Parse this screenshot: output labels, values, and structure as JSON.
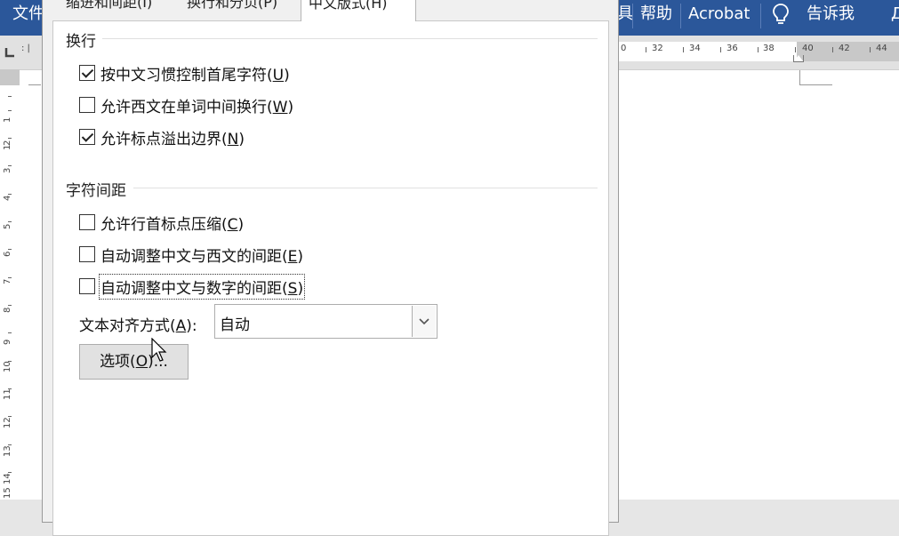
{
  "ribbon": {
    "file_tab": "文件",
    "tab_partial": "具",
    "help_tab": "帮助",
    "acrobat_tab": "Acrobat",
    "tell_me": "告诉我",
    "share_partial": "Д"
  },
  "ruler": {
    "labels": [
      "0",
      "32",
      "34",
      "36",
      "38",
      "40",
      "42",
      "44"
    ]
  },
  "vertical_ruler": {
    "labels": [
      "1",
      "1",
      "2",
      "3",
      "4",
      "5",
      "6",
      "7",
      "8",
      "9",
      "10",
      "11",
      "12",
      "13",
      "14",
      "15"
    ]
  },
  "dialog": {
    "tabs": {
      "indent_spacing": "缩进和间距(I)",
      "line_page_breaks": "换行和分页(P)",
      "asian_typography": "中文版式(H)"
    },
    "line_break_group": {
      "title": "换行",
      "options": [
        {
          "pre": "按中文习惯控制首尾字符(",
          "key": "U",
          "post": ")",
          "checked": true
        },
        {
          "pre": "允许西文在单词中间换行(",
          "key": "W",
          "post": ")",
          "checked": false
        },
        {
          "pre": "允许标点溢出边界(",
          "key": "N",
          "post": ")",
          "checked": true
        }
      ]
    },
    "char_spacing_group": {
      "title": "字符间距",
      "options": [
        {
          "pre": "允许行首标点压缩(",
          "key": "C",
          "post": ")",
          "checked": false
        },
        {
          "pre": "自动调整中文与西文的间距(",
          "key": "E",
          "post": ")",
          "checked": false
        },
        {
          "pre": "自动调整中文与数字的间距(",
          "key": "S",
          "post": ")",
          "checked": false
        }
      ]
    },
    "text_alignment": {
      "label_pre": "文本对齐方式(",
      "label_key": "A",
      "label_post": "):",
      "value": "自动"
    },
    "options_button": {
      "pre": "选项(",
      "key": "O",
      "post": ")..."
    }
  }
}
